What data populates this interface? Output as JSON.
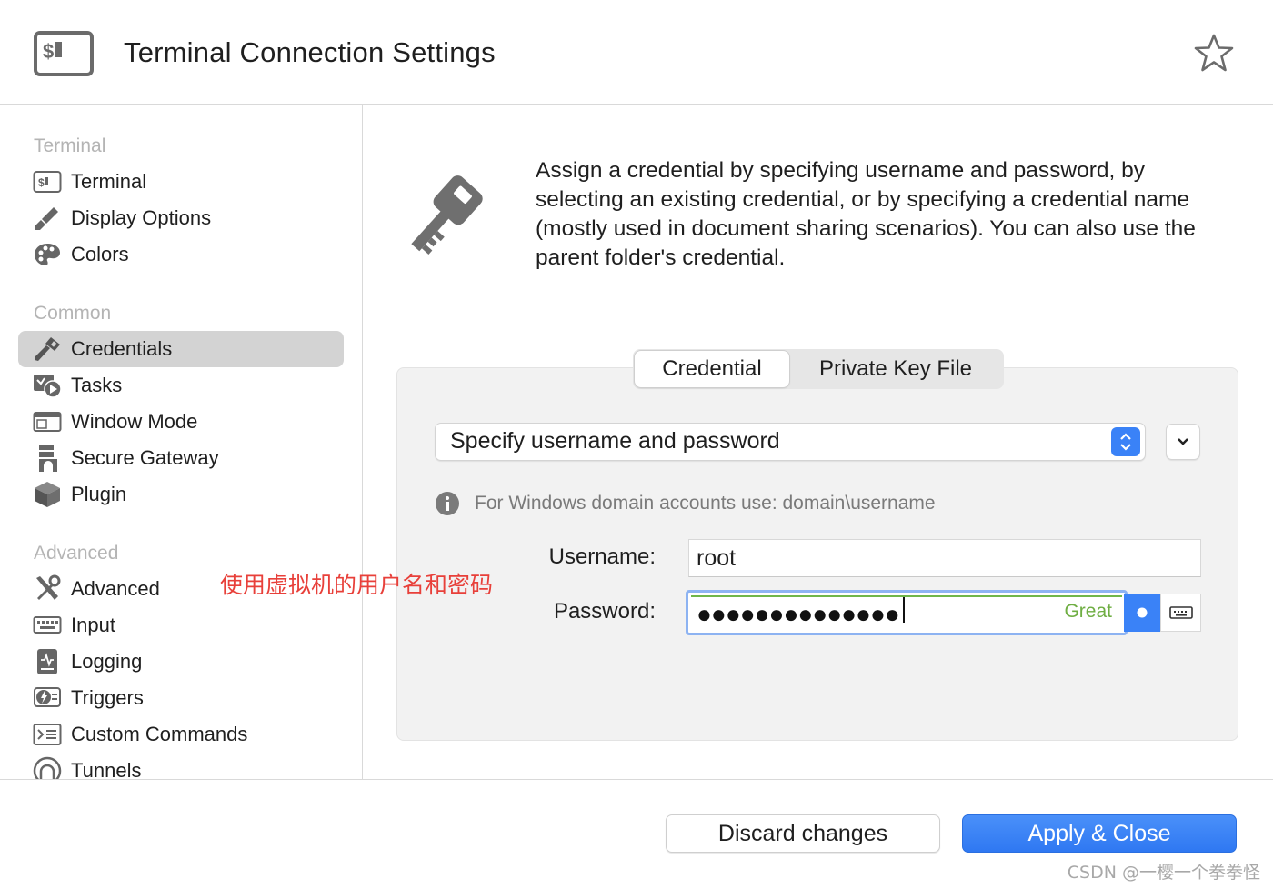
{
  "window": {
    "title": "Terminal Connection Settings"
  },
  "sidebar": {
    "sections": [
      {
        "title": "Terminal",
        "items": [
          {
            "label": "Terminal",
            "icon": "terminal-icon"
          },
          {
            "label": "Display Options",
            "icon": "brush-icon"
          },
          {
            "label": "Colors",
            "icon": "palette-icon"
          }
        ]
      },
      {
        "title": "Common",
        "items": [
          {
            "label": "Credentials",
            "icon": "key-icon",
            "active": true
          },
          {
            "label": "Tasks",
            "icon": "tasks-icon"
          },
          {
            "label": "Window Mode",
            "icon": "window-icon"
          },
          {
            "label": "Secure Gateway",
            "icon": "gateway-icon"
          },
          {
            "label": "Plugin",
            "icon": "cube-icon"
          }
        ]
      },
      {
        "title": "Advanced",
        "items": [
          {
            "label": "Advanced",
            "icon": "tools-icon"
          },
          {
            "label": "Input",
            "icon": "keyboard-icon"
          },
          {
            "label": "Logging",
            "icon": "log-icon"
          },
          {
            "label": "Triggers",
            "icon": "trigger-icon"
          },
          {
            "label": "Custom Commands",
            "icon": "command-icon"
          },
          {
            "label": "Tunnels",
            "icon": "tunnel-icon"
          }
        ]
      }
    ]
  },
  "main": {
    "description": "Assign a credential by specifying username and password, by selecting an existing credential, or by specifying a credential name (mostly used in document sharing scenarios). You can also use the parent folder's credential.",
    "tabs": [
      {
        "label": "Credential",
        "selected": true
      },
      {
        "label": "Private Key File",
        "selected": false
      }
    ],
    "mode_select": {
      "value": "Specify username and password"
    },
    "info_text": "For Windows domain accounts use: domain\\username",
    "username": {
      "label": "Username:",
      "value": "root"
    },
    "password": {
      "label": "Password:",
      "masked": "●●●●●●●●●●●●●●",
      "strength": "Great"
    }
  },
  "annotation": "使用虚拟机的用户名和密码",
  "footer": {
    "discard_label": "Discard changes",
    "apply_label": "Apply & Close"
  },
  "watermark": "CSDN @一樱一个拳拳怪",
  "colors": {
    "accent": "#3a82f7",
    "strength_good": "#6fae43",
    "annotation": "#e8403a"
  }
}
